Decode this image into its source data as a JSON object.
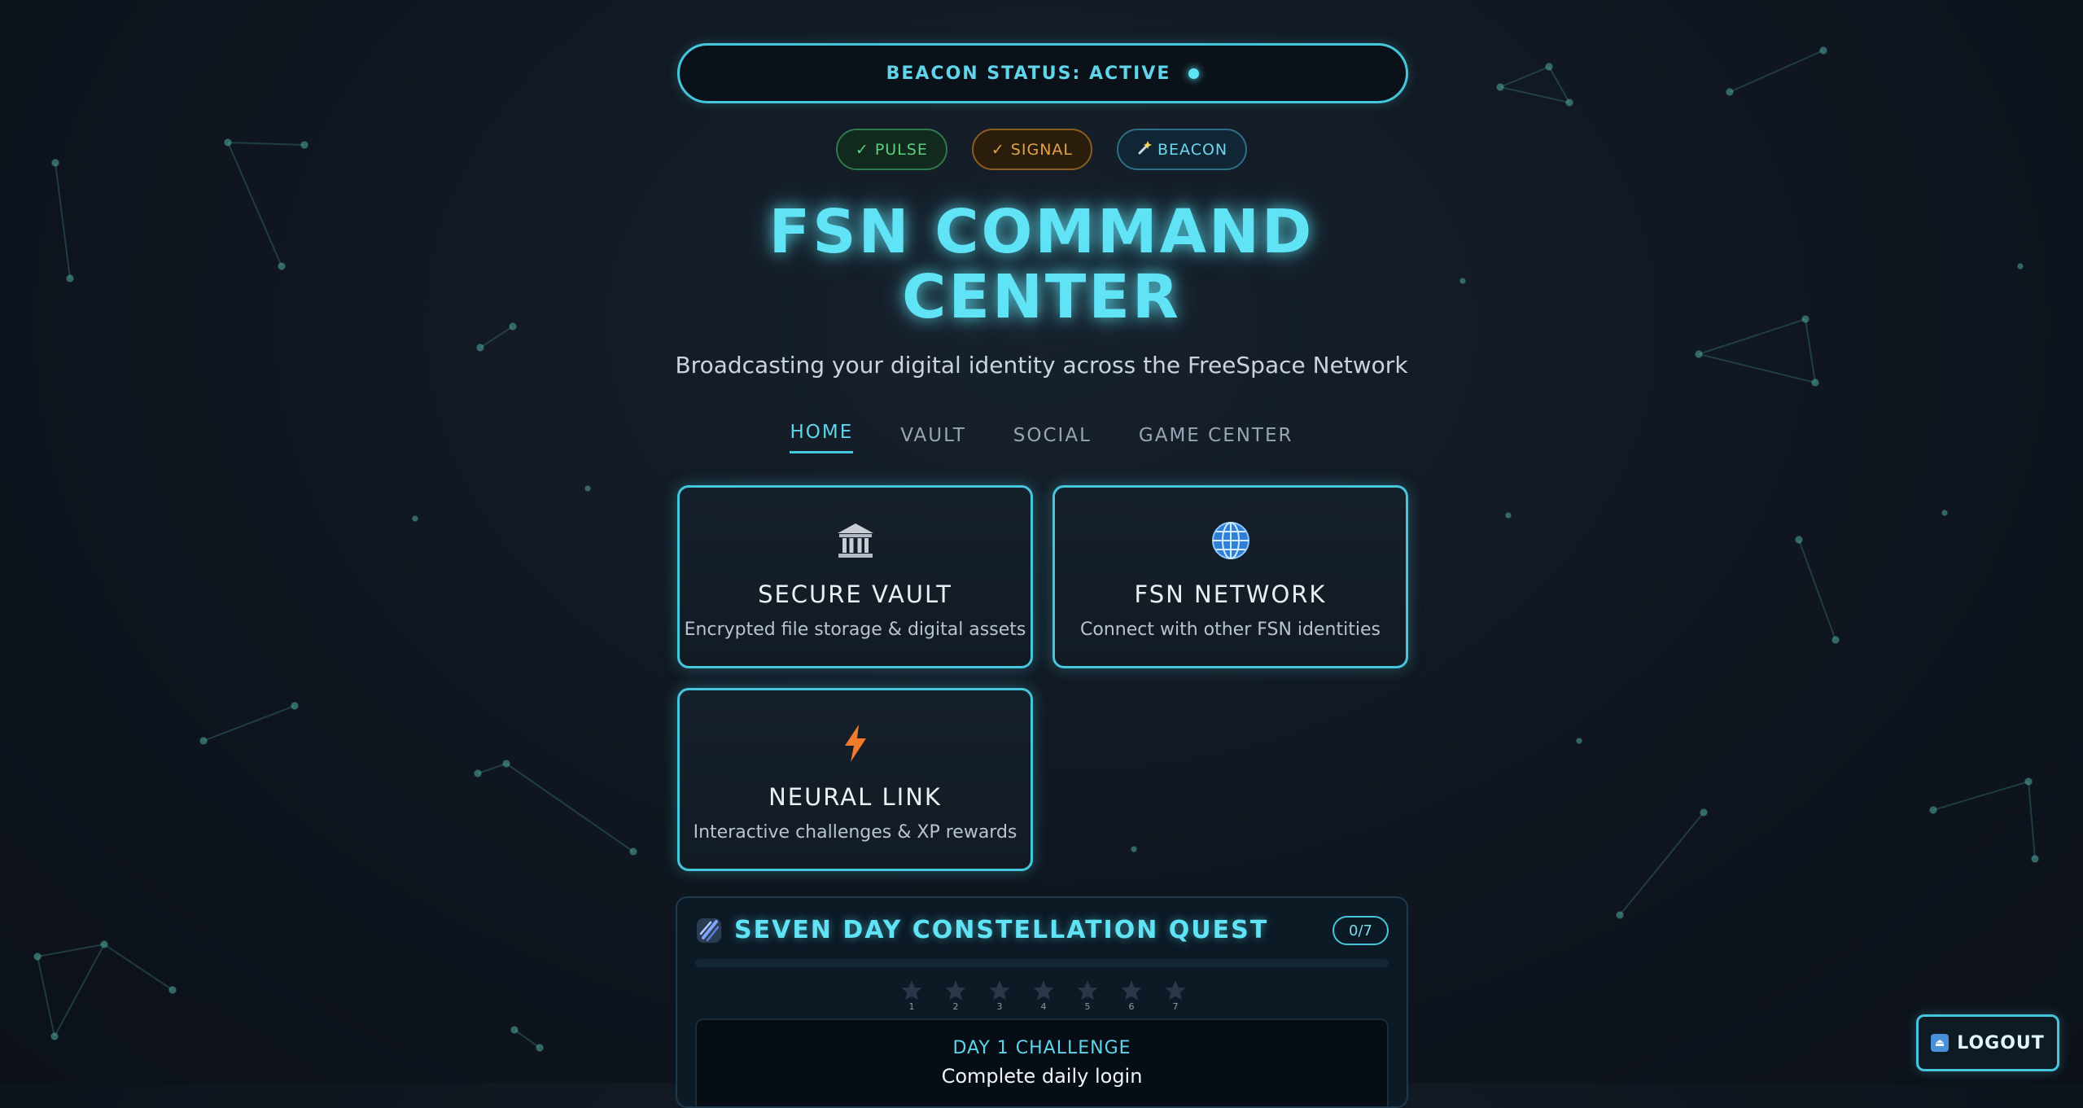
{
  "status_bar": {
    "text": "BEACON STATUS: ACTIVE"
  },
  "pills": [
    {
      "label": "✓ PULSE"
    },
    {
      "label": "✓ SIGNAL"
    },
    {
      "label": "BEACON",
      "icon": "wand-icon"
    }
  ],
  "hero": {
    "title_line1": "FSN COMMAND",
    "title_line2": "CENTER",
    "subtitle": "Broadcasting your digital identity across the FreeSpace Network"
  },
  "nav": {
    "tabs": [
      {
        "label": "HOME",
        "active": true
      },
      {
        "label": "VAULT"
      },
      {
        "label": "SOCIAL"
      },
      {
        "label": "GAME CENTER"
      }
    ]
  },
  "cards": [
    {
      "title": "SECURE VAULT",
      "desc": "Encrypted file storage & digital assets",
      "icon": "bank-icon"
    },
    {
      "title": "FSN NETWORK",
      "desc": "Connect with other FSN identities",
      "icon": "globe-icon"
    },
    {
      "title": "NEURAL LINK",
      "desc": "Interactive challenges & XP rewards",
      "icon": "lightning-icon"
    }
  ],
  "quest": {
    "title": "SEVEN DAY CONSTELLATION QUEST",
    "progress": "0/7",
    "stars": [
      "1",
      "2",
      "3",
      "4",
      "5",
      "6",
      "7"
    ],
    "challenge_label": "DAY 1 CHALLENGE",
    "challenge_text": "Complete daily login"
  },
  "logout": {
    "label": "LOGOUT"
  },
  "colors": {
    "accent": "#46c6dc",
    "title": "#5fe3f5",
    "background": "#0f161f"
  }
}
